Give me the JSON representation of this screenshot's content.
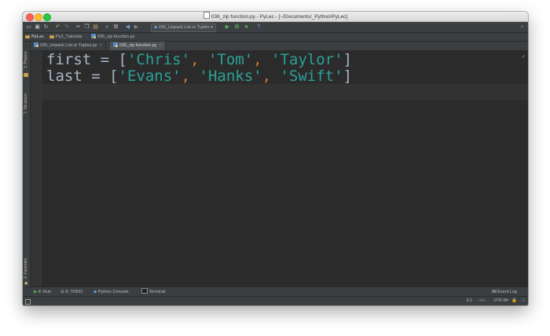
{
  "window": {
    "title": "036_zip function.py - PyLec - [~/Documents/_Python/PyLec]"
  },
  "toolbar": {
    "run_config": "035_Unpack List or Tuples",
    "icons": [
      "folder-icon",
      "save-icon",
      "sync-icon",
      "undo-icon",
      "redo-icon",
      "cut-icon",
      "copy-icon",
      "paste-icon",
      "find-icon",
      "replace-icon",
      "back-icon",
      "forward-icon",
      "run-icon",
      "debug-icon",
      "coverage-icon",
      "help-icon",
      "search-icon"
    ]
  },
  "navbar": {
    "crumbs": [
      "PyLec",
      "Py3_Tutorials",
      "036_zip function.py"
    ]
  },
  "left_tools": {
    "project": "1: Project",
    "structure": "7: Structure",
    "favorites": "2: Favorites"
  },
  "tabs": [
    {
      "label": "035_Unpack List or Tuples.py",
      "active": false
    },
    {
      "label": "036_zip function.py",
      "active": true
    }
  ],
  "editor": {
    "line1": {
      "var": "first",
      "op": " = ",
      "open": "[",
      "s1": "'Chris'",
      "c1": ", ",
      "s2": "'Tom'",
      "c2": ", ",
      "s3": "'Taylor'",
      "close": "]"
    },
    "line2": {
      "var": "last",
      "op": " = ",
      "open": "[",
      "s1": "'Evans'",
      "c1": ", ",
      "s2": "'Hanks'",
      "c2": ", ",
      "s3": "'Swift'",
      "close": "]"
    }
  },
  "bottom_tools": {
    "run": "4: Run",
    "todo": "6: TODO",
    "python_console": "Python Console",
    "terminal": "Terminal",
    "event_log": "Event Log"
  },
  "status": {
    "position": "3:1",
    "line_sep": "n/a",
    "encoding": "UTF-8≠"
  },
  "colors": {
    "editor_bg": "#2b2b2b",
    "string": "#2aa198",
    "comma": "#cc7832",
    "identifier": "#a9b7c6"
  }
}
